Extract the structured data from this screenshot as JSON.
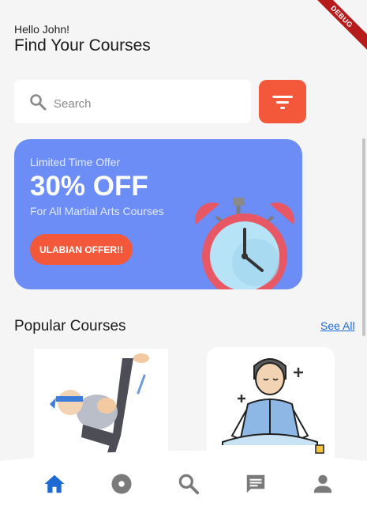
{
  "debug_banner": "DEBUG",
  "header": {
    "greeting": "Hello John!",
    "title": "Find Your Courses"
  },
  "search": {
    "placeholder": "Search",
    "icon": "search-icon"
  },
  "filter": {
    "icon": "filter-icon",
    "color": "#f4583a"
  },
  "promo": {
    "kicker": "Limited Time Offer",
    "headline": "30% OFF",
    "subtitle": "For All Martial Arts Courses",
    "button_label": "ULABIAN OFFER!!",
    "background": "#6b8df5",
    "image": "alarm-clock-illustration"
  },
  "popular": {
    "title": "Popular Courses",
    "see_all": "See All",
    "courses": [
      {
        "image": "martial-arts-kick-illustration"
      },
      {
        "image": "meditation-illustration"
      }
    ]
  },
  "bottom_nav": {
    "items": [
      {
        "icon": "home-icon",
        "active": true
      },
      {
        "icon": "disc-icon",
        "active": false
      },
      {
        "icon": "search-icon",
        "active": false
      },
      {
        "icon": "chat-icon",
        "active": false
      },
      {
        "icon": "person-icon",
        "active": false
      }
    ],
    "active_color": "#1e6ad3",
    "inactive_color": "#7a7a7a"
  }
}
